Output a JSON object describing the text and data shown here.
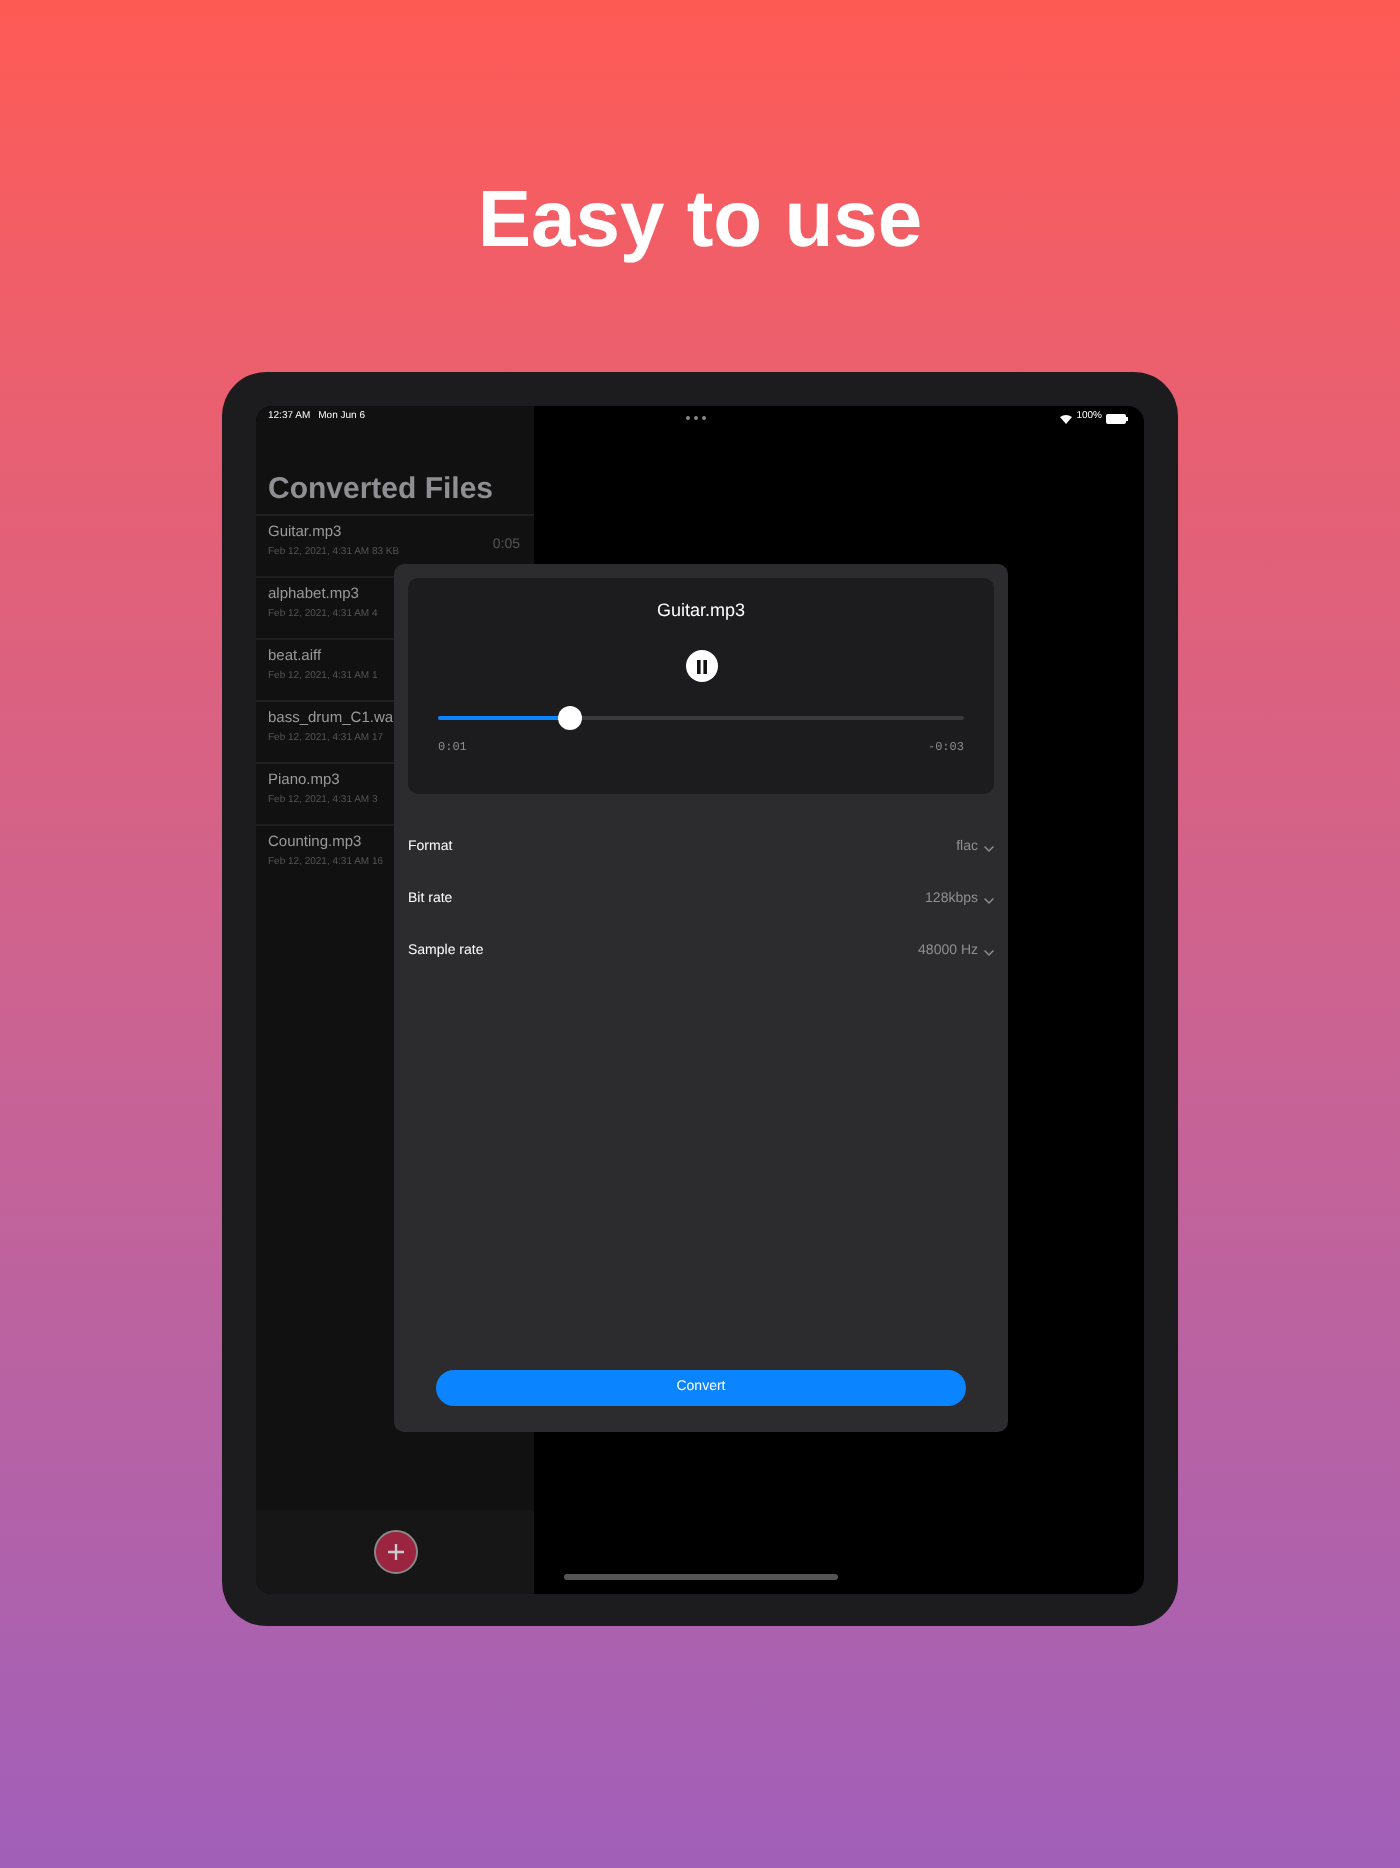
{
  "headline": "Easy to use",
  "status_bar": {
    "time": "12:37 AM",
    "date": "Mon Jun 6",
    "battery": "100%"
  },
  "sidebar": {
    "title": "Converted Files",
    "files": [
      {
        "name": "Guitar.mp3",
        "meta": "Feb 12, 2021, 4:31 AM  83 KB",
        "duration": "0:05"
      },
      {
        "name": "alphabet.mp3",
        "meta": "Feb 12, 2021, 4:31 AM  4"
      },
      {
        "name": "beat.aiff",
        "meta": "Feb 12, 2021, 4:31 AM  1"
      },
      {
        "name": "bass_drum_C1.wa",
        "meta": "Feb 12, 2021, 4:31 AM  17"
      },
      {
        "name": "Piano.mp3",
        "meta": "Feb 12, 2021, 4:31 AM  3"
      },
      {
        "name": "Counting.mp3",
        "meta": "Feb 12, 2021, 4:31 AM  16"
      }
    ]
  },
  "player": {
    "title": "Guitar.mp3",
    "playing": true,
    "level": 0.25,
    "elapsed": "0:01",
    "remaining": "-0:03"
  },
  "settings": [
    {
      "label": "Format",
      "value": "flac"
    },
    {
      "label": "Bit rate",
      "value": "128kbps"
    },
    {
      "label": "Sample rate",
      "value": "48000 Hz"
    }
  ],
  "convert_button": "Convert"
}
